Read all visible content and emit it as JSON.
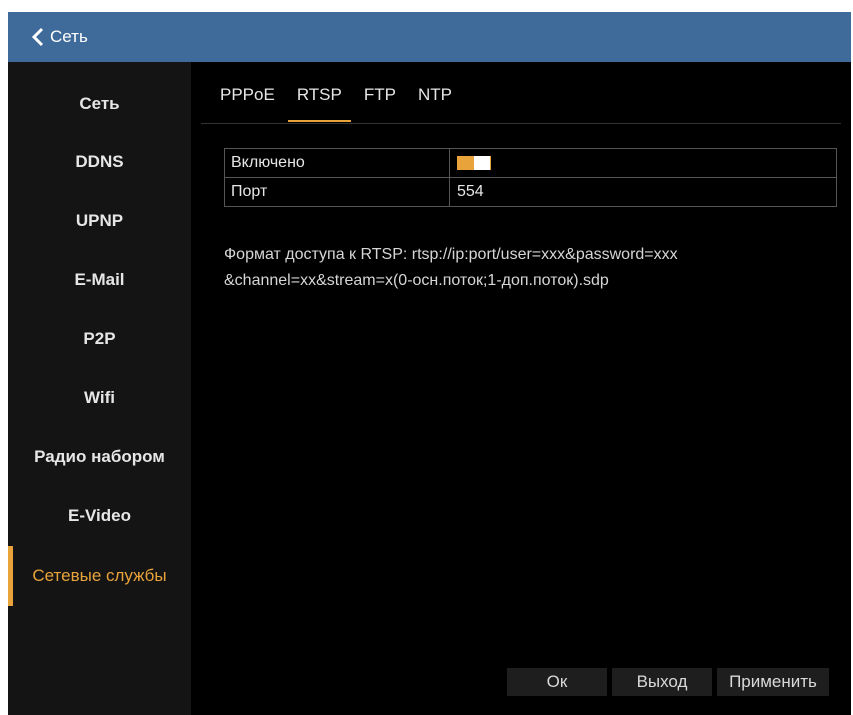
{
  "header": {
    "back_label": "Сеть"
  },
  "sidebar": {
    "items": [
      {
        "label": "Сеть"
      },
      {
        "label": "DDNS"
      },
      {
        "label": "UPNP"
      },
      {
        "label": "E-Mail"
      },
      {
        "label": "P2P"
      },
      {
        "label": "Wifi"
      },
      {
        "label": "Радио набором"
      },
      {
        "label": "E-Video"
      },
      {
        "label": "Сетевые службы"
      }
    ],
    "active_index": 8
  },
  "tabs": [
    {
      "label": "PPPoE"
    },
    {
      "label": "RTSP"
    },
    {
      "label": "FTP"
    },
    {
      "label": "NTP"
    }
  ],
  "active_tab": "RTSP",
  "settings": {
    "enabled_label": "Включено",
    "enabled_value": true,
    "port_label": "Порт",
    "port_value": "554"
  },
  "info": {
    "line1": "Формат доступа к RTSP: rtsp://ip:port/user=xxx&password=xxx",
    "line2": "&channel=xx&stream=x(0-осн.поток;1-доп.поток).sdp"
  },
  "buttons": {
    "ok": "Ок",
    "exit": "Выход",
    "apply": "Применить"
  },
  "colors": {
    "accent": "#e8a33a",
    "titlebar": "#3f6b9b",
    "sidebar_bg": "#141414",
    "content_bg": "#000000"
  }
}
